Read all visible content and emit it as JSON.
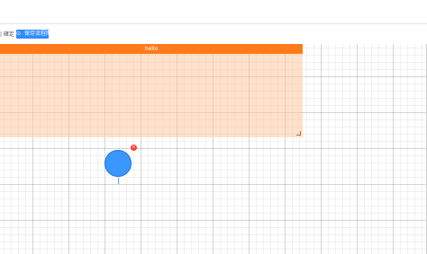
{
  "toolbar": {
    "left_text": "| 確定",
    "button_label": "保存流程图",
    "button_icon": "⊙"
  },
  "node": {
    "title": "hello"
  },
  "circle": {
    "badge_text": "×"
  },
  "colors": {
    "header_orange": "#ff7a1a",
    "node_fill": "#fdc9a0",
    "primary_blue": "#2f8cff",
    "circle_blue": "#3a97ff",
    "badge_red": "#ff3b30"
  }
}
